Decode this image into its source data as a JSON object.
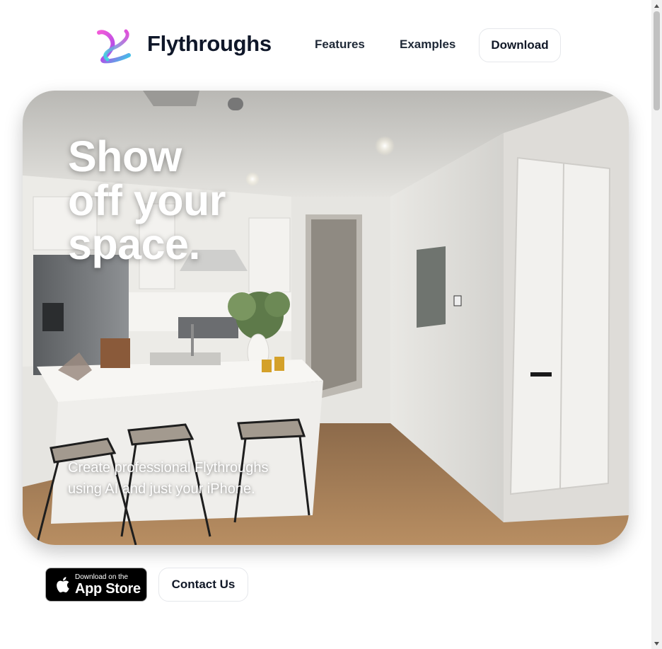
{
  "header": {
    "brand_name": "Flythroughs",
    "logo_icon": "flythroughs-logo-icon",
    "nav": {
      "features": "Features",
      "examples": "Examples",
      "download": "Download"
    }
  },
  "hero": {
    "headline_lines": [
      "Show",
      "off your",
      "space."
    ],
    "subtitle_lines": [
      "Create professional Flythroughs",
      "using AI and just your iPhone."
    ],
    "image": "kitchen-interior-photo"
  },
  "cta": {
    "appstore_small": "Download on the",
    "appstore_big": "App Store",
    "appstore_icon": "apple-icon",
    "contact": "Contact Us"
  },
  "colors": {
    "text_dark": "#0f1729",
    "button_border": "#e5e7eb",
    "logo_pink": "#e03ad6",
    "logo_cyan": "#2fd3e8"
  }
}
